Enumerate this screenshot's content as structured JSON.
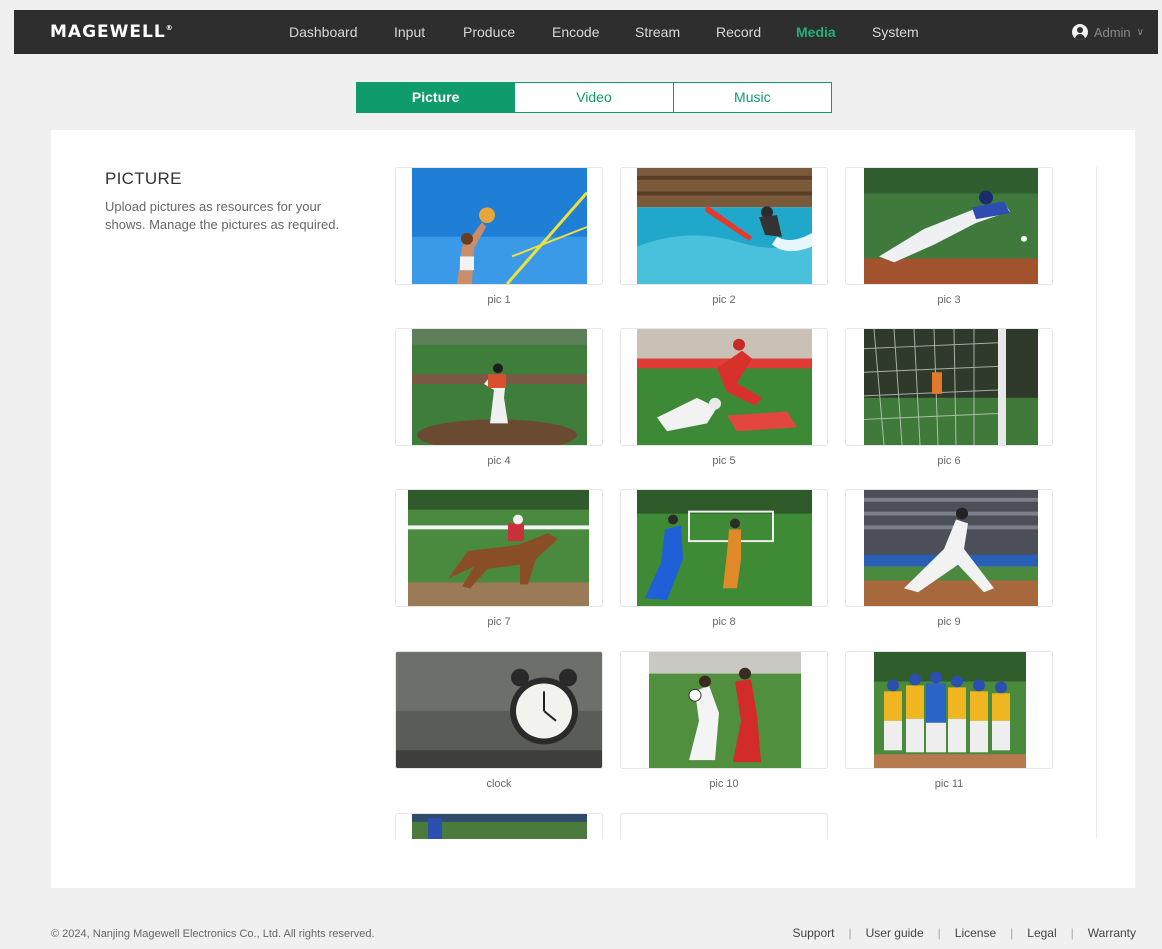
{
  "brand": {
    "name": "MAGEWELL",
    "mark": "®"
  },
  "nav": {
    "items": [
      "Dashboard",
      "Input",
      "Produce",
      "Encode",
      "Stream",
      "Record",
      "Media",
      "System"
    ],
    "active": "Media"
  },
  "user": {
    "name": "Admin",
    "chevron": "∨"
  },
  "tabs": {
    "picture": "Picture",
    "video": "Video",
    "music": "Music",
    "active": "Picture"
  },
  "section": {
    "title": "PICTURE",
    "description": "Upload pictures as resources for your shows. Manage the pictures as required."
  },
  "pictures": [
    {
      "name": "pic 1",
      "icon": "volleyball-image"
    },
    {
      "name": "pic 2",
      "icon": "surfing-image"
    },
    {
      "name": "pic 3",
      "icon": "baseball-dive-image"
    },
    {
      "name": "pic 4",
      "icon": "baseball-pitcher-image"
    },
    {
      "name": "pic 5",
      "icon": "football-tackle-image"
    },
    {
      "name": "pic 6",
      "icon": "soccer-goal-net-image"
    },
    {
      "name": "pic 7",
      "icon": "horse-race-image"
    },
    {
      "name": "pic 8",
      "icon": "soccer-match-image"
    },
    {
      "name": "pic 9",
      "icon": "baseball-pitch-stadium-image"
    },
    {
      "name": "clock",
      "icon": "alarm-clock-image"
    },
    {
      "name": "pic 10",
      "icon": "soccer-duel-image"
    },
    {
      "name": "pic 11",
      "icon": "baseball-team-image"
    },
    {
      "name": "",
      "icon": "partial-image"
    },
    {
      "name": "",
      "icon": "empty-slot"
    }
  ],
  "footer": {
    "copyright": "© 2024, Nanjing Magewell Electronics Co., Ltd. All rights reserved.",
    "links": [
      "Support",
      "User guide",
      "License",
      "Legal",
      "Warranty"
    ],
    "separator": "|"
  },
  "colors": {
    "accent": "#0f9b6c",
    "nav_bg": "#2e2e2e",
    "nav_active": "#22b07a"
  }
}
